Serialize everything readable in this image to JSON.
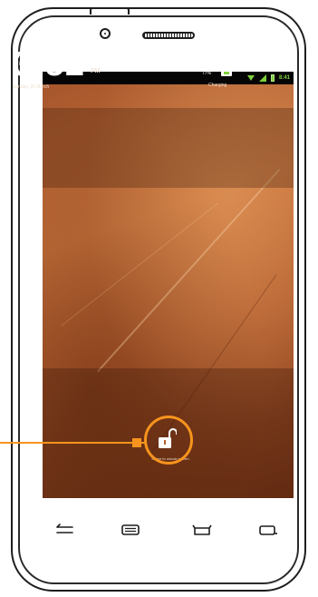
{
  "lock_screen": {
    "status_bar": {
      "time": "8:41",
      "icons": [
        "wifi-icon",
        "signal-icon",
        "battery-icon"
      ],
      "accent": "#7fd13b"
    },
    "clock": {
      "time": "3:52",
      "ampm": "PM",
      "date": "Sunday, 25 March"
    },
    "battery": {
      "percent": "77%",
      "status": "Charging"
    },
    "unlock": {
      "icon": "unlock-padlock-icon",
      "label": "Swipe to unlock screen"
    }
  },
  "navigation_bar": {
    "buttons": [
      "back-icon",
      "menu-icon",
      "home-icon",
      "recent-apps-icon"
    ]
  },
  "callout": {
    "color": "#f7941d",
    "target": "unlock-padlock-icon"
  }
}
